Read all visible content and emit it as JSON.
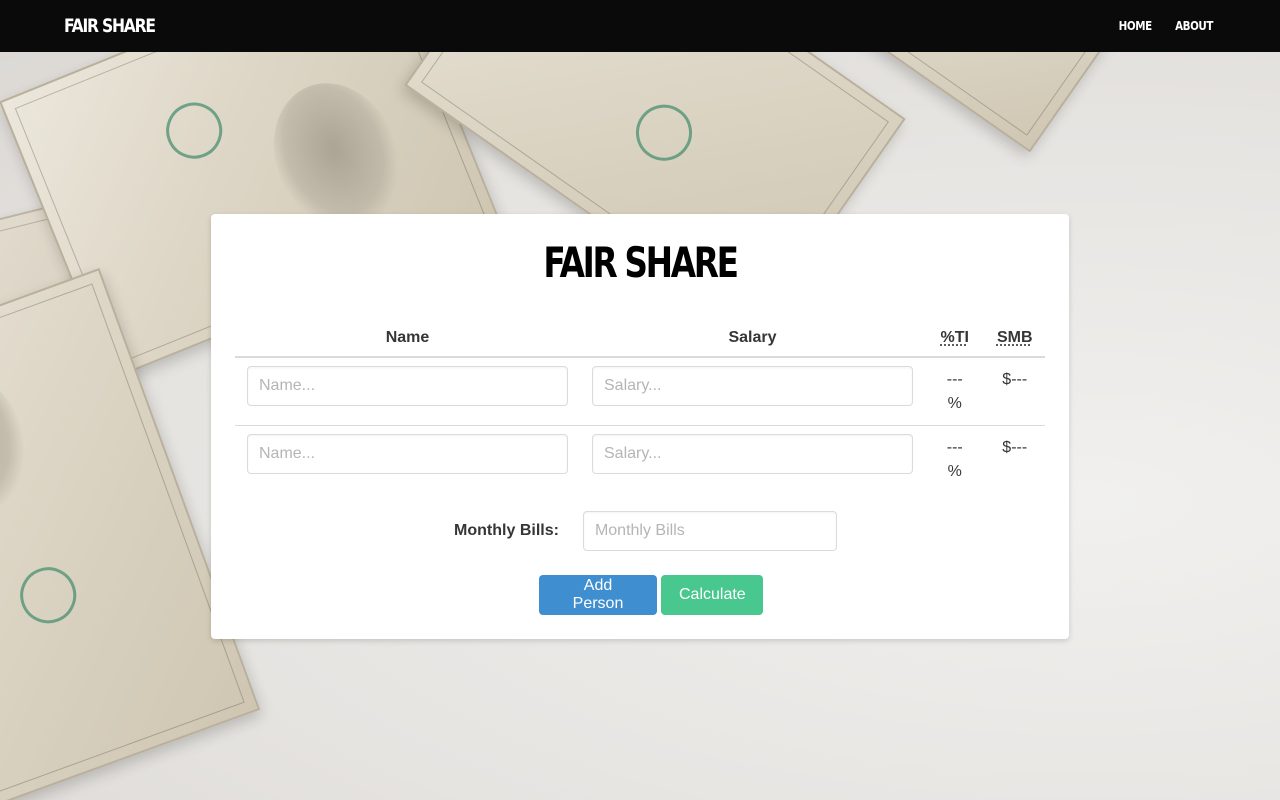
{
  "navbar": {
    "brand": "FAIR SHARE",
    "links": [
      "HOME",
      "ABOUT"
    ]
  },
  "card": {
    "title": "FAIR SHARE",
    "table": {
      "headers": [
        "Name",
        "Salary",
        "%TI",
        "SMB"
      ],
      "rows": [
        {
          "name_placeholder": "Name...",
          "salary_placeholder": "Salary...",
          "percent": "---\n%",
          "smb": "$---"
        },
        {
          "name_placeholder": "Name...",
          "salary_placeholder": "Salary...",
          "percent": "---\n%",
          "smb": "$---"
        }
      ]
    },
    "monthly_bills": {
      "label": "Monthly Bills:",
      "placeholder": "Monthly Bills"
    },
    "buttons": {
      "add_person": "Add Person",
      "calculate": "Calculate"
    }
  },
  "colors": {
    "navbar_bg": "#0a0a0a",
    "add_button": "#3e8ed0",
    "calculate_button": "#48c78e"
  }
}
